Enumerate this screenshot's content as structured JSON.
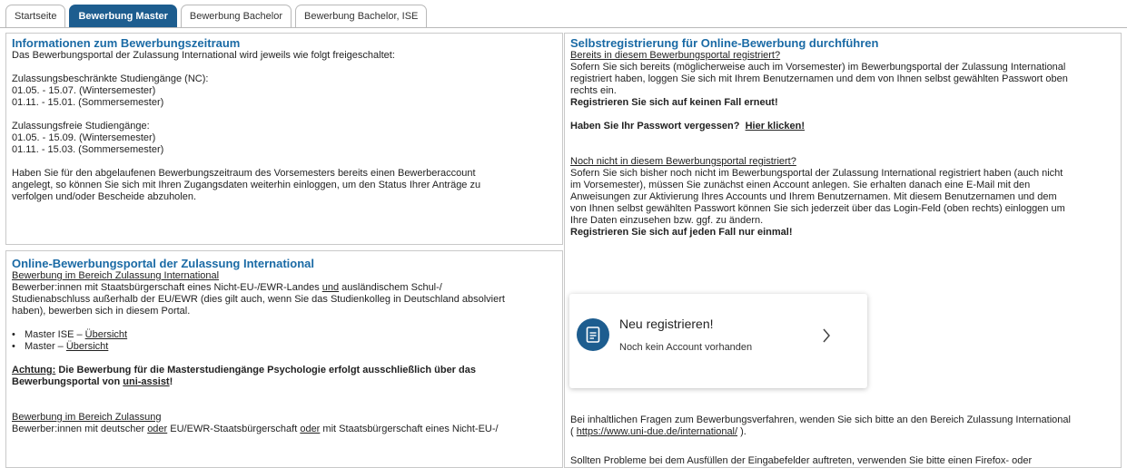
{
  "tabs": [
    {
      "label": "Startseite",
      "active": false
    },
    {
      "label": "Bewerbung Master",
      "active": true
    },
    {
      "label": "Bewerbung Bachelor",
      "active": false
    },
    {
      "label": "Bewerbung Bachelor, ISE",
      "active": false
    }
  ],
  "colors": {
    "accent": "#1d5d8f",
    "heading": "#1a6aa5"
  },
  "info": {
    "title": "Informationen zum Bewerbungszeitraum",
    "intro": "Das Bewerbungsportal der Zulassung International wird jeweils wie folgt freigeschaltet:",
    "nc_heading": "Zulassungsbeschränkte Studiengänge (NC):",
    "nc_ws": "01.05. - 15.07. (Wintersemester)",
    "nc_ss": "01.11. - 15.01. (Sommersemester)",
    "free_heading": "Zulassungsfreie Studiengänge:",
    "free_ws": "01.05. - 15.09. (Wintersemester)",
    "free_ss": "01.11. - 15.03. (Sommersemester)",
    "account_1": "Haben Sie für den abgelaufenen Bewerbungszeitraum des Vorsemesters bereits einen Bewerberaccount",
    "account_2": "angelegt, so können Sie sich mit Ihren Zugangsdaten weiterhin einloggen, um den Status Ihrer Anträge zu",
    "account_3": "verfolgen und/oder Bescheide abzuholen."
  },
  "portal": {
    "title": "Online-Bewerbungsportal der Zulassung International",
    "section1_heading": "Bewerbung im Bereich Zulassung International",
    "s1_line1_a": "Bewerber:innen mit Staatsbürgerschaft eines Nicht-EU-/EWR-Landes ",
    "s1_line1_und": "und",
    "s1_line1_b": " ausländischem Schul-/",
    "s1_line2": "Studienabschluss außerhalb der EU/EWR (dies gilt auch, wenn Sie das Studienkolleg in Deutschland absolviert",
    "s1_line3": "haben), bewerben sich in diesem Portal.",
    "bullet1_label": "Master ISE – ",
    "bullet1_link": "Übersicht",
    "bullet2_label": "Master – ",
    "bullet2_link": "Übersicht",
    "achtung_word": "Achtung:",
    "achtung_text": " Die Bewerbung für die Masterstudiengänge Psychologie erfolgt ausschließlich über das",
    "achtung_line2": "Bewerbungsportal von ",
    "achtung_link": "uni-assist",
    "achtung_end": "!",
    "section2_heading": "Bewerbung im Bereich Zulassung",
    "s2_line1_a": "Bewerber:innen mit deutscher ",
    "s2_oder1": "oder",
    "s2_line1_b": " EU/EWR-Staatsbürgerschaft ",
    "s2_oder2": "oder",
    "s2_line1_c": " mit Staatsbürgerschaft eines Nicht-EU-/"
  },
  "selfreg": {
    "title": "Selbstregistrierung für Online-Bewerbung durchführen",
    "reg_heading": "Bereits in diesem Bewerbungsportal registriert?",
    "reg_line1": "Sofern Sie sich bereits (möglicherweise auch im Vorsemester) im Bewerbungsportal der Zulassung International",
    "reg_line2": "registriert haben, loggen Sie sich mit Ihrem Benutzernamen und dem von Ihnen selbst gewählten Passwort oben",
    "reg_line3": "rechts ein.",
    "reg_warning": "Registrieren Sie sich auf keinen Fall erneut!",
    "pw_question": "Haben Sie Ihr Passwort vergessen?",
    "pw_link": "Hier klicken!",
    "new_heading": "Noch nicht in diesem Bewerbungsportal registriert?",
    "new_line1": "Sofern Sie sich bisher noch nicht im Bewerbungsportal der Zulassung International registriert haben (auch nicht",
    "new_line2": "im Vorsemester), müssen Sie zunächst einen Account anlegen. Sie erhalten danach eine E-Mail mit den",
    "new_line3": "Anweisungen zur Aktivierung Ihres Accounts und Ihrem Benutzernamen. Mit diesem Benutzernamen und dem",
    "new_line4": "von Ihnen selbst gewählten Passwort können Sie sich jederzeit über das Login-Feld (oben rechts) einloggen um",
    "new_line5": "Ihre Daten einzusehen bzw. ggf. zu ändern.",
    "new_warning": "Registrieren Sie sich auf jeden Fall nur einmal!",
    "card_title": "Neu registrieren!",
    "card_sub": "Noch kein Account vorhanden",
    "card_icon": "document-icon",
    "card_chevron": "chevron-right-icon",
    "contact_line1": "Bei inhaltlichen Fragen zum Bewerbungsverfahren, wenden Sie sich bitte an den Bereich Zulassung International",
    "contact_open": "( ",
    "contact_link": "https://www.uni-due.de/international/",
    "contact_close": " ).",
    "problems_line": "Sollten Probleme bei dem Ausfüllen der Eingabefelder auftreten, verwenden Sie bitte einen Firefox- oder"
  }
}
